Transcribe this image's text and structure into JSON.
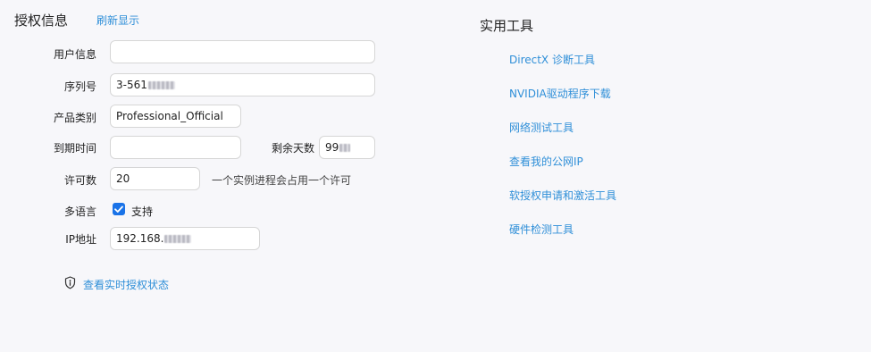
{
  "license": {
    "title": "授权信息",
    "refresh_label": "刷新显示",
    "fields": {
      "user_info_label": "用户信息",
      "user_info_value": "",
      "serial_label": "序列号",
      "serial_value": "3-561",
      "product_type_label": "产品类别",
      "product_type_value": "Professional_Official",
      "expiry_label": "到期时间",
      "expiry_value": "",
      "remaining_days_label": "剩余天数",
      "remaining_days_value": "99",
      "license_count_label": "许可数",
      "license_count_value": "20",
      "license_count_hint": "一个实例进程会占用一个许可",
      "multilang_label": "多语言",
      "multilang_checked": true,
      "multilang_option": "支持",
      "ip_label": "IP地址",
      "ip_value": "192.168."
    },
    "realtime_link": "查看实时授权状态",
    "realtime_icon": "shield-info-icon"
  },
  "tools": {
    "title": "实用工具",
    "items": [
      "DirectX 诊断工具",
      "NVIDIA驱动程序下载",
      "网络测试工具",
      "查看我的公网IP",
      "软授权申请和激活工具",
      "硬件检测工具"
    ]
  },
  "colors": {
    "background": "#f7f7fa",
    "link": "#2f8fd8",
    "checkbox": "#1a73e8"
  }
}
